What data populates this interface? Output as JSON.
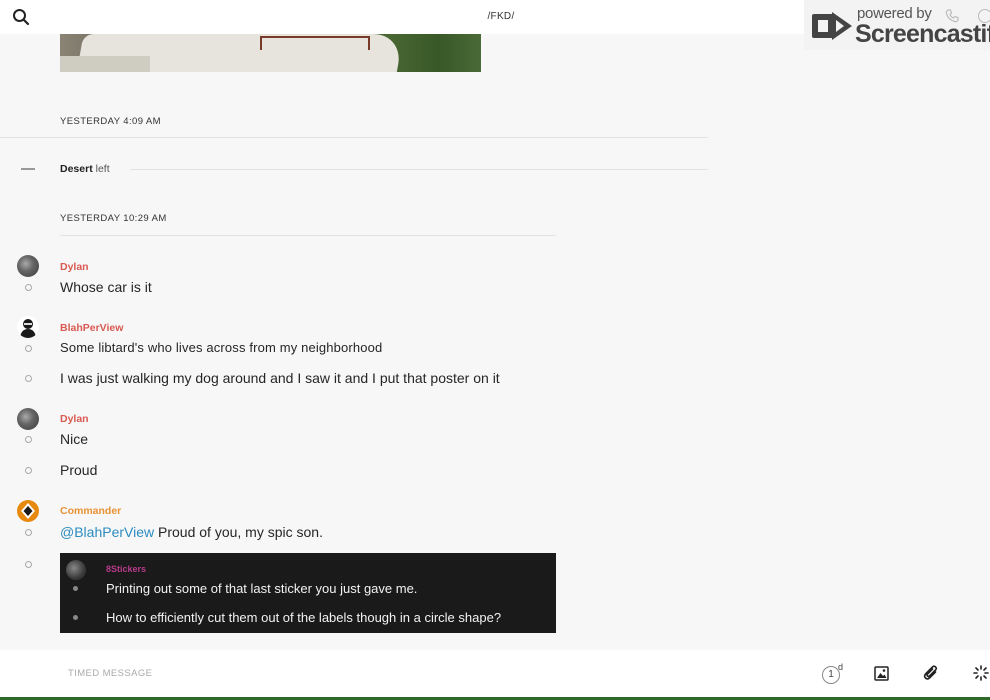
{
  "header": {
    "channel_name": "/FKD/",
    "search_icon": "search-icon",
    "phone_icon": "phone-icon",
    "info_icon": "info-icon"
  },
  "watermark": {
    "powered_by": "powered by",
    "brand": "Screencastify"
  },
  "feed": {
    "timestamp_1": "YESTERDAY 4:09 AM",
    "system_event": {
      "name": "Desert",
      "verb": "left"
    },
    "timestamp_2": "YESTERDAY 10:29 AM",
    "groups": [
      {
        "user": "Dylan",
        "user_color": "#d85a52",
        "messages": [
          "Whose car is it"
        ]
      },
      {
        "user": "BlahPerView",
        "user_color": "#d85a52",
        "messages": [
          "Some libtard's who lives across from my neighborhood",
          "I was just walking my dog around and I saw it and I put that poster on it"
        ]
      },
      {
        "user": "Dylan",
        "user_color": "#d85a52",
        "messages": [
          "Nice",
          "Proud"
        ]
      },
      {
        "user": "Commander",
        "user_color": "#e89233",
        "mention": "@BlahPerView",
        "messages": [
          " Proud of you, my spic son."
        ]
      }
    ],
    "quoted_embed": {
      "user": "8Stickers",
      "user_color": "#b73a8a",
      "messages": [
        "Printing out some of that last sticker you just gave me.",
        "How to efficiently cut them out of the labels though in a circle shape?"
      ]
    }
  },
  "composer": {
    "placeholder": "TIMED MESSAGE",
    "timer_value": "1",
    "timer_unit": "d",
    "icons": [
      "timer-icon",
      "image-icon",
      "paperclip-icon",
      "spinner-icon"
    ]
  }
}
